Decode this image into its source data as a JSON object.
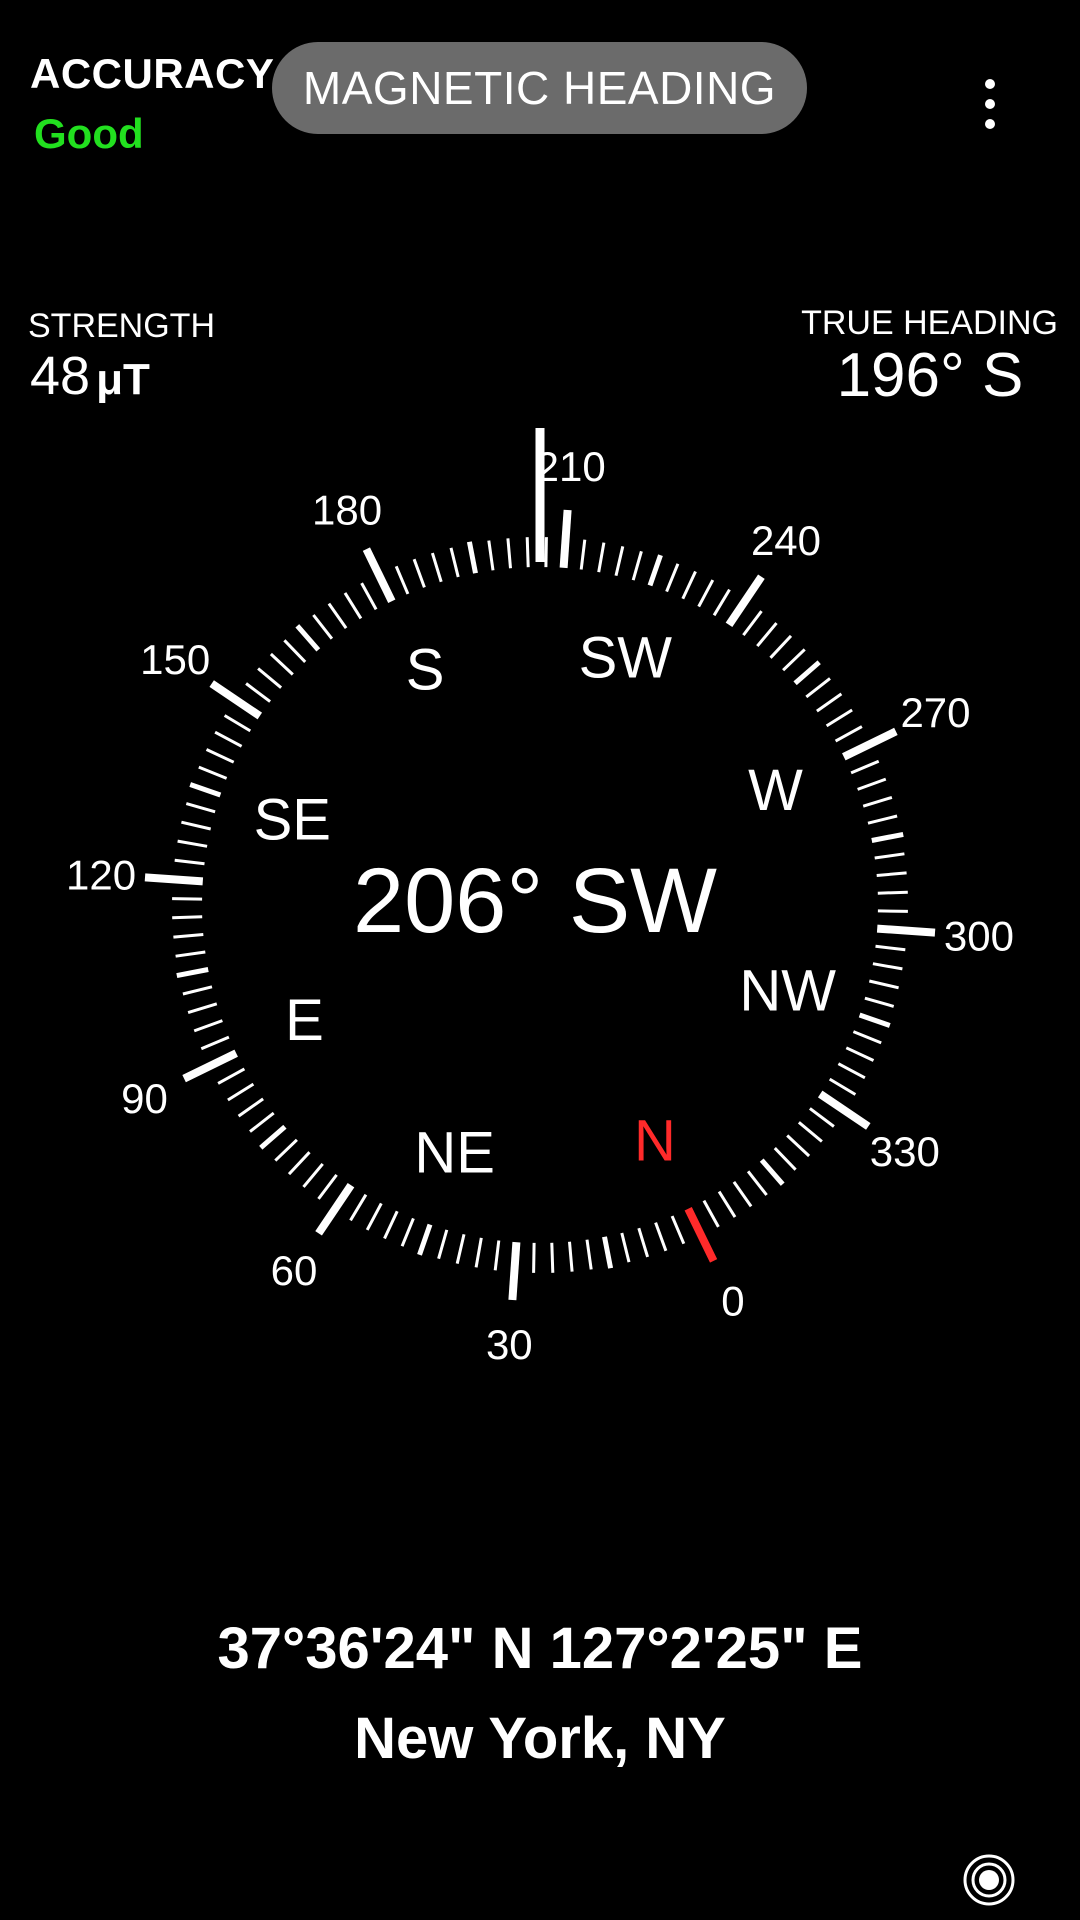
{
  "header": {
    "accuracy_label": "ACCURACY",
    "accuracy_value": "Good",
    "accuracy_color": "#22e01f",
    "mode_button_label": "MAGNETIC HEADING",
    "menu_icon": "more-vertical-icon"
  },
  "readouts": {
    "strength_label": "STRENGTH",
    "strength_value": "48",
    "strength_unit": "μT",
    "true_heading_label": "TRUE HEADING",
    "true_heading_value": "196° S"
  },
  "compass": {
    "heading_degrees": 206,
    "center_readout": "206° SW",
    "north_color": "#ff2a2a",
    "degree_labels": [
      "0",
      "30",
      "60",
      "90",
      "120",
      "150",
      "180",
      "210",
      "240",
      "270",
      "300",
      "330"
    ],
    "cardinal_labels": [
      "N",
      "NE",
      "E",
      "SE",
      "S",
      "SW",
      "W",
      "NW"
    ]
  },
  "location": {
    "coordinates": "37°36'24\" N 127°2'25\" E",
    "place": "New York, NY"
  },
  "footer": {
    "camera_icon": "camera-toggle-icon"
  }
}
